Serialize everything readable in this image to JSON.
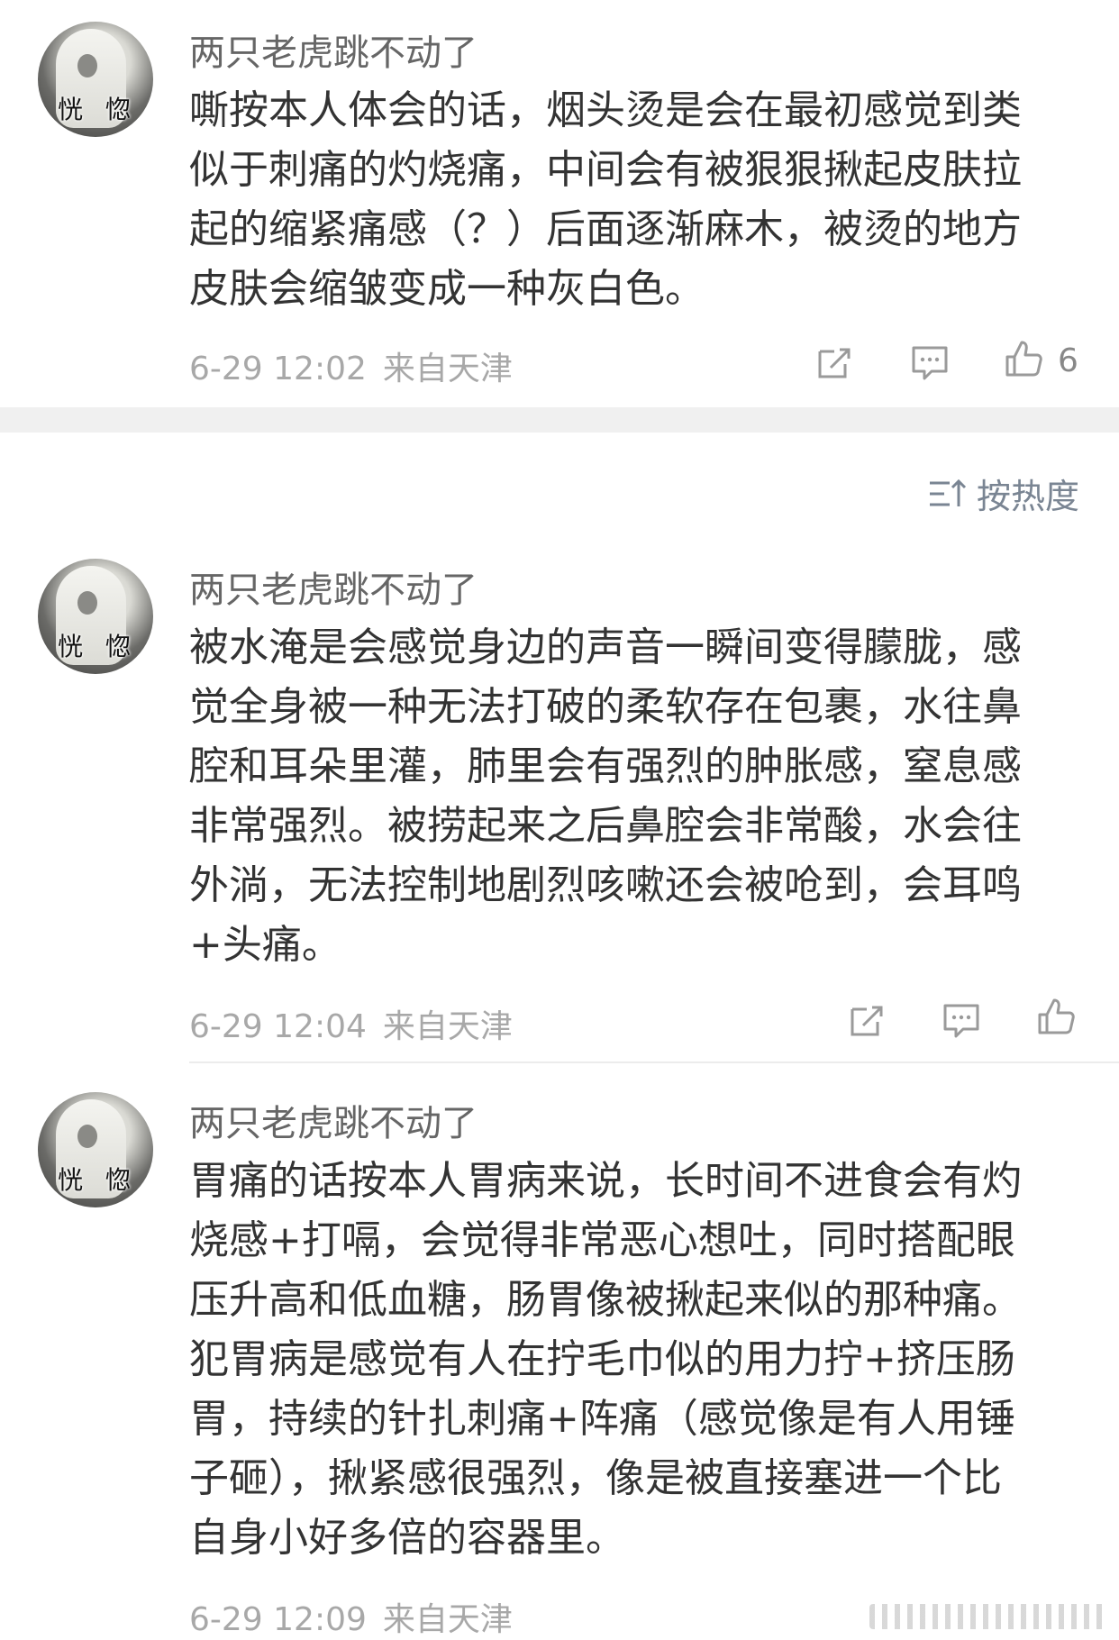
{
  "sort_label": "按热度",
  "comments": [
    {
      "avatar_text": "恍 惚",
      "username": "两只老虎跳不动了",
      "text": "嘶按本人体会的话，烟头烫是会在最初感觉到类\n似于刺痛的灼烧痛，中间会有被狠狠揪起皮肤拉\n起的缩紧痛感（？）后面逐渐麻木，被烫的地方\n皮肤会缩皱变成一种灰白色。",
      "time": "6-29 12:02",
      "location": "来自天津",
      "like_count": "6"
    },
    {
      "avatar_text": "恍 惚",
      "username": "两只老虎跳不动了",
      "text": "被水淹是会感觉身边的声音一瞬间变得朦胧，感\n觉全身被一种无法打破的柔软存在包裹，水往鼻\n腔和耳朵里灌，肺里会有强烈的肿胀感，窒息感\n非常强烈。被捞起来之后鼻腔会非常酸，水会往\n外淌，无法控制地剧烈咳嗽还会被呛到，会耳鸣\n+头痛。",
      "time": "6-29 12:04",
      "location": "来自天津",
      "like_count": ""
    },
    {
      "avatar_text": "恍 惚",
      "username": "两只老虎跳不动了",
      "text": "胃痛的话按本人胃病来说，长时间不进食会有灼\n烧感+打嗝，会觉得非常恶心想吐，同时搭配眼\n压升高和低血糖，肠胃像被揪起来似的那种痛。\n犯胃病是感觉有人在拧毛巾似的用力拧+挤压肠\n胃，持续的针扎刺痛+阵痛（感觉像是有人用锤\n子砸），揪紧感很强烈，像是被直接塞进一个比\n自身小好多倍的容器里。",
      "time": "6-29 12:09",
      "location": "来自天津",
      "like_count": ""
    }
  ]
}
